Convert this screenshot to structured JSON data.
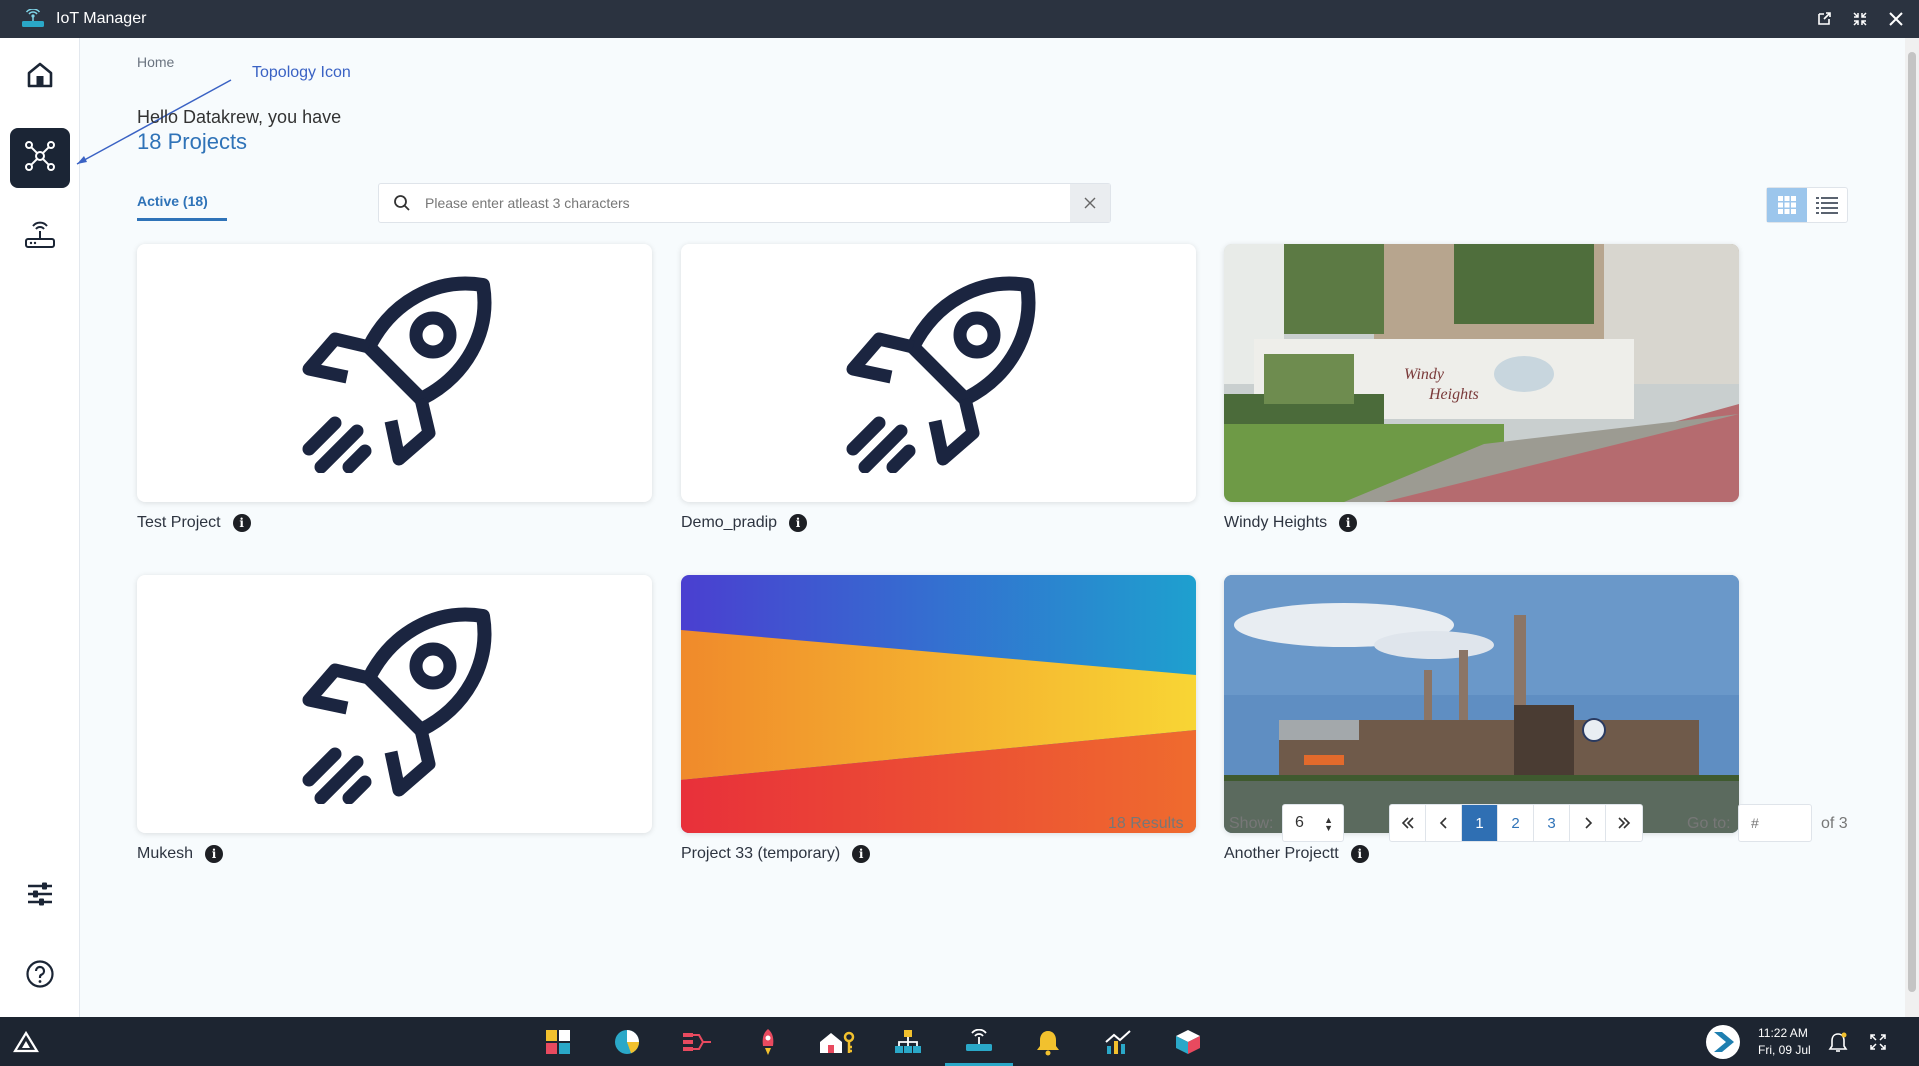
{
  "window": {
    "title": "IoT Manager"
  },
  "breadcrumb": "Home",
  "annotation": "Topology Icon",
  "greeting": "Hello Datakrew, you have",
  "project_count": "18 Projects",
  "tabs": {
    "active": "Active (18)"
  },
  "search": {
    "placeholder": "Please enter atleast 3 characters",
    "value": ""
  },
  "projects": [
    {
      "name": "Test Project",
      "thumb": "rocket-icon"
    },
    {
      "name": "Demo_pradip",
      "thumb": "rocket-icon"
    },
    {
      "name": "Windy Heights",
      "thumb": "building-photo"
    },
    {
      "name": "Mukesh",
      "thumb": "rocket-icon"
    },
    {
      "name": "Project 33 (temporary)",
      "thumb": "gradient-image"
    },
    {
      "name": "Another Projectt",
      "thumb": "factory-photo"
    }
  ],
  "pagination": {
    "results": "18 Results",
    "show_label": "Show:",
    "show_value": "6",
    "pages": [
      "1",
      "2",
      "3"
    ],
    "current_page": "1",
    "goto_label": "Go to:",
    "goto_placeholder": "#",
    "of_label": "of 3"
  },
  "clock": {
    "time": "11:22 AM",
    "date": "Fri, 09 Jul"
  },
  "colors": {
    "accent": "#2f73b8",
    "sidebar_active": "#1b2535",
    "titlebar": "#2b3340",
    "taskbar": "#1d2531"
  },
  "taskbar_icons": [
    "app-grid-icon",
    "pie-chart-icon",
    "flow-icon",
    "rocket-app-icon",
    "home-key-icon",
    "hierarchy-icon",
    "iot-router-icon",
    "bell-app-icon",
    "analytics-icon",
    "cube-icon"
  ]
}
